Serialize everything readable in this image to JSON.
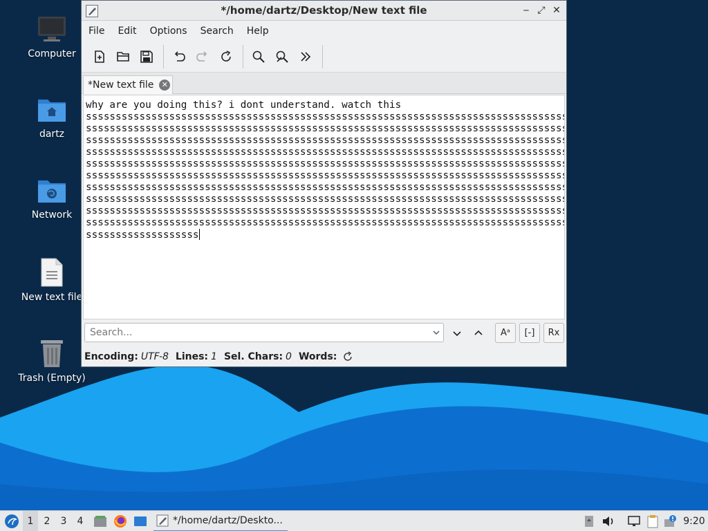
{
  "desktop": {
    "icons": [
      {
        "label": "Computer",
        "icon": "monitor-icon"
      },
      {
        "label": "dartz",
        "icon": "home-folder-icon"
      },
      {
        "label": "Network",
        "icon": "network-folder-icon"
      },
      {
        "label": "New text file",
        "icon": "text-file-icon"
      },
      {
        "label": "Trash (Empty)",
        "icon": "trash-icon"
      }
    ],
    "colors": {
      "background": "#0a2949",
      "wave_light": "#1aa3f0",
      "wave_dark": "#0c6fd0"
    }
  },
  "window": {
    "title": "*/home/dartz/Desktop/New text file",
    "controls": {
      "minimize": "‒",
      "maximize": "⤢",
      "close": "✕"
    },
    "menu": [
      "File",
      "Edit",
      "Options",
      "Search",
      "Help"
    ],
    "toolbar": [
      "new-file-icon",
      "open-folder-icon",
      "save-icon",
      "undo-icon",
      "redo-icon",
      "reload-icon",
      "find-icon",
      "find-replace-icon",
      "goto-icon"
    ],
    "tab": {
      "label": "*New text file",
      "close": "✕"
    },
    "editor": {
      "lines": [
        "why are you doing this? i dont understand. watch this",
        "ssssssssssssssssssssssssssssssssssssssssssssssssssssssssssssssssssssssssssssssssssss",
        "ssssssssssssssssssssssssssssssssssssssssssssssssssssssssssssssssssssssssssssssssssss",
        "ssssssssssssssssssssssssssssssssssssssssssssssssssssssssssssssssssssssssssssssssssss",
        "ssssssssssssssssssssssssssssssssssssssssssssssssssssssssssssssssssssssssssssssssssss",
        "ssssssssssssssssssssssssssssssssssssssssssssssssssssssssssssssssssssssssssssssssssss",
        "ssssssssssssssssssssssssssssssssssssssssssssssssssssssssssssssssssssssssssssssssssss",
        "ssssssssssssssssssssssssssssssssssssssssssssssssssssssssssssssssssssssssssssssssssss",
        "ssssssssssssssssssssssssssssssssssssssssssssssssssssssssssssssssssssssssssssssssssss",
        "ssssssssssssssssssssssssssssssssssssssssssssssssssssssssssssssssssssssssssssssssssss",
        "ssssssssssssssssssssssssssssssssssssssssssssssssssssssssssssssssssssssssssssssssssss",
        "sssssssssssssssssss"
      ]
    },
    "search": {
      "placeholder": "Search...",
      "buttons": {
        "next": "⌄",
        "prev": "⌃",
        "match_case": "Aᵃ",
        "whole_word": "[-]",
        "regex": "Rx"
      }
    },
    "status": {
      "encoding_label": "Encoding:",
      "encoding_value": "UTF-8",
      "lines_label": "Lines:",
      "lines_value": "1",
      "sel_label": "Sel. Chars:",
      "sel_value": "0",
      "words_label": "Words:"
    }
  },
  "taskbar": {
    "workspaces": [
      "1",
      "2",
      "3",
      "4"
    ],
    "active_workspace": "1",
    "task_label": "*/home/dartz/Deskto...",
    "clock": "9:20",
    "tray_icons": [
      "removable-drive-icon",
      "volume-icon",
      "network-wired-icon",
      "clipboard-icon",
      "update-notifier-icon"
    ]
  }
}
